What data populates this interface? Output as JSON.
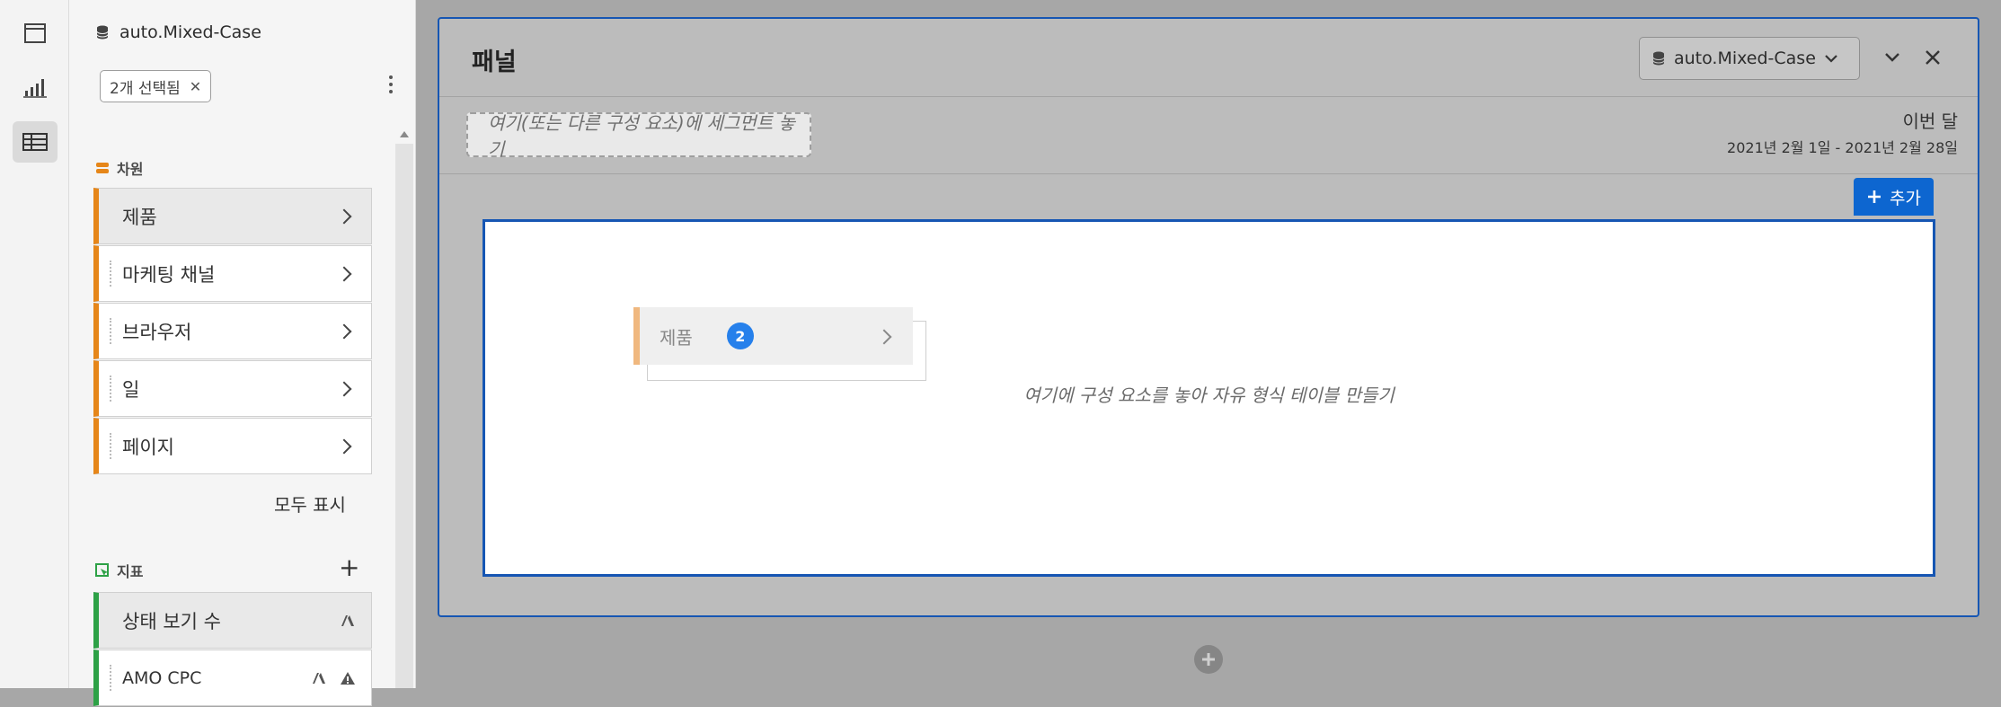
{
  "rail": {
    "icons": [
      "panel-icon",
      "visualization-icon",
      "components-icon"
    ]
  },
  "sidebar": {
    "report_suite": "auto.Mixed-Case",
    "selection_tag": "2개 선택됨",
    "dimensions": {
      "heading": "차원",
      "items": [
        {
          "label": "제품"
        },
        {
          "label": "마케팅 채널"
        },
        {
          "label": "브라우저"
        },
        {
          "label": "일"
        },
        {
          "label": "페이지"
        }
      ],
      "show_all": "모두 표시"
    },
    "metrics": {
      "heading": "지표",
      "items": [
        {
          "label": "상태 보기 수"
        },
        {
          "label": "AMO CPC"
        }
      ]
    }
  },
  "panel": {
    "title": "패널",
    "report_suite": "auto.Mixed-Case",
    "segment_placeholder": "여기(또는 다른 구성 요소)에 세그먼트 놓기",
    "date_label": "이번 달",
    "date_range": "2021년 2월 1일 - 2021년 2월 28일",
    "add_label": "추가",
    "drop_hint": "여기에 구성 요소를 놓아 자유 형식 테이블 만들기",
    "drag_item": {
      "label": "제품",
      "count": "2"
    }
  },
  "colors": {
    "accent": "#1656b3",
    "dimension": "#e68619",
    "metric": "#2da146",
    "add_button": "#0d66d0",
    "badge": "#2680eb"
  }
}
